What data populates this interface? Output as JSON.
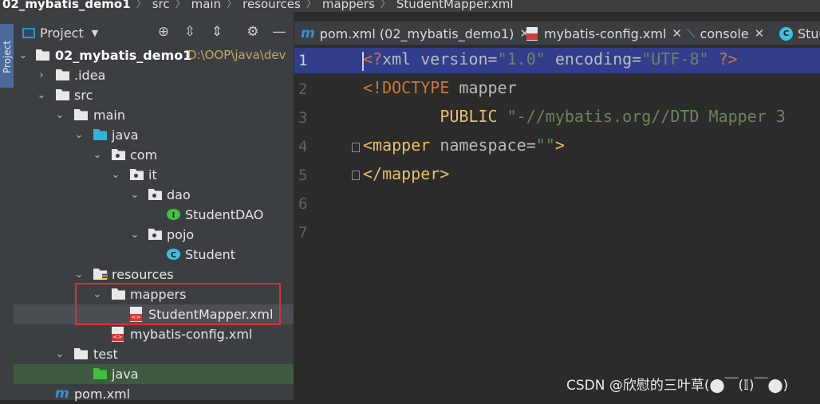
{
  "breadcrumb": {
    "project": "02_mybatis_demo1",
    "parts": [
      "src",
      "main",
      "resources",
      "mappers"
    ],
    "file": "StudentMapper.xml"
  },
  "side_tool": {
    "label": "Project"
  },
  "project_panel": {
    "title": "Project",
    "toolbar": [
      "target-icon",
      "expand-all-icon",
      "collapse-all-icon",
      "gear-icon",
      "minimize-icon"
    ],
    "root": {
      "name": "02_mybatis_demo1",
      "path": "D:\\OOP\\java\\dev"
    },
    "tree": [
      {
        "label": ".idea"
      },
      {
        "label": "src"
      },
      {
        "label": "main"
      },
      {
        "label": "java"
      },
      {
        "label": "com"
      },
      {
        "label": "it"
      },
      {
        "label": "dao"
      },
      {
        "label": "StudentDAO",
        "badge": "I"
      },
      {
        "label": "pojo"
      },
      {
        "label": "Student",
        "badge": "C"
      },
      {
        "label": "resources"
      },
      {
        "label": "mappers"
      },
      {
        "label": "StudentMapper.xml"
      },
      {
        "label": "mybatis-config.xml"
      },
      {
        "label": "test"
      },
      {
        "label": "java"
      },
      {
        "label": "pom.xml"
      }
    ]
  },
  "editor": {
    "tabs": [
      {
        "label": "pom.xml (02_mybatis_demo1)",
        "icon": "m"
      },
      {
        "label": "mybatis-config.xml"
      },
      {
        "label": "console"
      },
      {
        "label": "Stud"
      }
    ],
    "line_numbers": [
      "1",
      "2",
      "3",
      "4",
      "5",
      "6",
      "7"
    ],
    "code": {
      "l1": {
        "a": "<?",
        "b": "xml",
        "c": " version=",
        "d": "\"1.0\"",
        "e": " encoding=",
        "f": "\"UTF-8\"",
        "g": " ?>"
      },
      "l2": {
        "a": "<!DOCTYPE ",
        "b": "mapper"
      },
      "l3": {
        "a": "        PUBLIC ",
        "b": "\"-//mybatis.org//DTD Mapper 3"
      },
      "l4": {
        "a": "<",
        "b": "mapper",
        "c": " namespace=",
        "d": "\"\"",
        "e": ">"
      },
      "l5": {
        "a": "</",
        "b": "mapper",
        "c": ">"
      }
    }
  },
  "watermark": "CSDN @欣慰的三叶草(⬤￣(𝕀)￣⬤)",
  "colors": {
    "accent_blue": "#3592c4",
    "current_line": "#323d8c",
    "selection_box": "#e03030"
  }
}
